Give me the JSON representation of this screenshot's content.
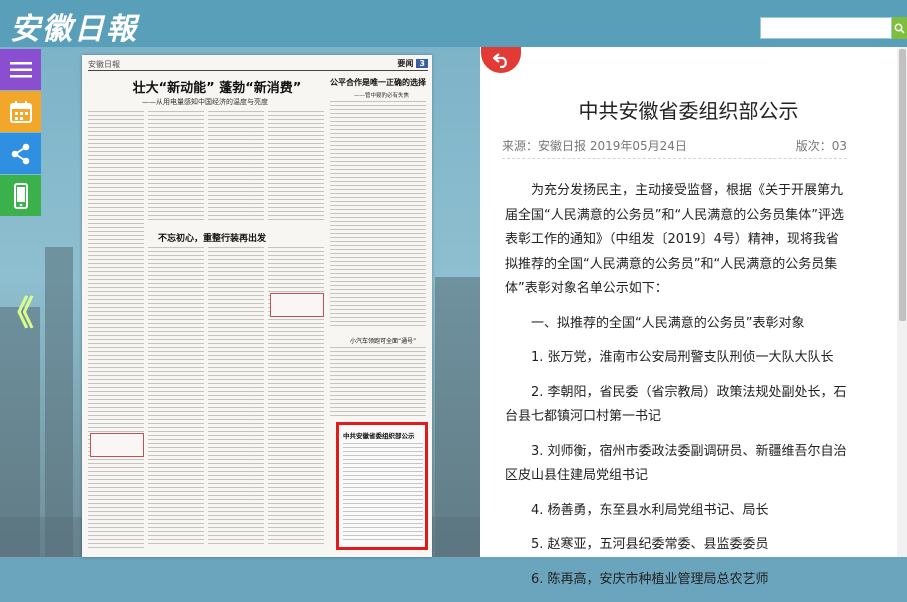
{
  "header": {
    "logo": "安徽日報",
    "search_placeholder": "",
    "colors": {
      "bar": "#5a9fba",
      "search_button": "#7dbf3a"
    }
  },
  "sidebar": {
    "buttons": [
      {
        "icon": "menu-icon",
        "color": "#8a4fd1"
      },
      {
        "icon": "calendar-icon",
        "color": "#f3a72a"
      },
      {
        "icon": "share-icon",
        "color": "#2f8fe0"
      },
      {
        "icon": "mobile-icon",
        "color": "#3ab14a"
      }
    ],
    "prev_arrow": "《"
  },
  "newspaper": {
    "masthead": "安徽日報",
    "section_label": "要闻",
    "section_number": "3",
    "headline": "壮大“新动能” 蓬勃“新消费”",
    "subhead": "——从用电量感知中国经济的温度与亮度",
    "side_headline": "公平合作是唯一正确的选择",
    "side_subhead": "——管中窥豹必有失焦",
    "headline_2": "不忘初心，重整行装再出发",
    "headline_3": "小汽车领跑可全面“通号”",
    "highlight_title": "中共安徽省委组织部公示"
  },
  "article": {
    "title": "中共安徽省委组织部公示",
    "source": "来源：安徽日报",
    "date": "2019年05月24日",
    "page": "版次：03",
    "paragraphs": [
      "为充分发扬民主，主动接受监督，根据《关于开展第九届全国“人民满意的公务员”和“人民满意的公务员集体”评选表彰工作的通知》（中组发〔2019〕4号）精神，现将我省拟推荐的全国“人民满意的公务员”和“人民满意的公务员集体”表彰对象名单公示如下：",
      "一、拟推荐的全国“人民满意的公务员”表彰对象",
      "1. 张万党，淮南市公安局刑警支队刑侦一大队大队长",
      "2. 李朝阳，省民委（省宗教局）政策法规处副处长，石台县七都镇河口村第一书记",
      "3. 刘师衡，宿州市委政法委副调研员、新疆维吾尔自治区皮山县住建局党组书记",
      "4. 杨善勇，东至县水利局党组书记、局长",
      "5. 赵寒亚，五河县纪委常委、县监委委员",
      "6. 陈再高，安庆市种植业管理局总农艺师"
    ]
  }
}
